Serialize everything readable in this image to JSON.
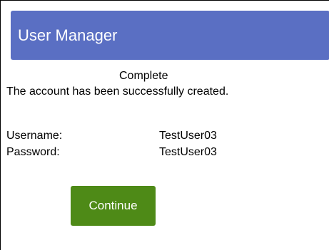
{
  "app": {
    "title": "User Manager"
  },
  "result": {
    "status": "Complete",
    "message": "The account has been successfully created."
  },
  "account": {
    "username_label": "Username:",
    "username_value": "TestUser03",
    "password_label": "Password:",
    "password_value": "TestUser03"
  },
  "actions": {
    "continue_label": "Continue"
  },
  "colors": {
    "header_bg": "#5a6fc3",
    "button_bg": "#4e8a17"
  }
}
